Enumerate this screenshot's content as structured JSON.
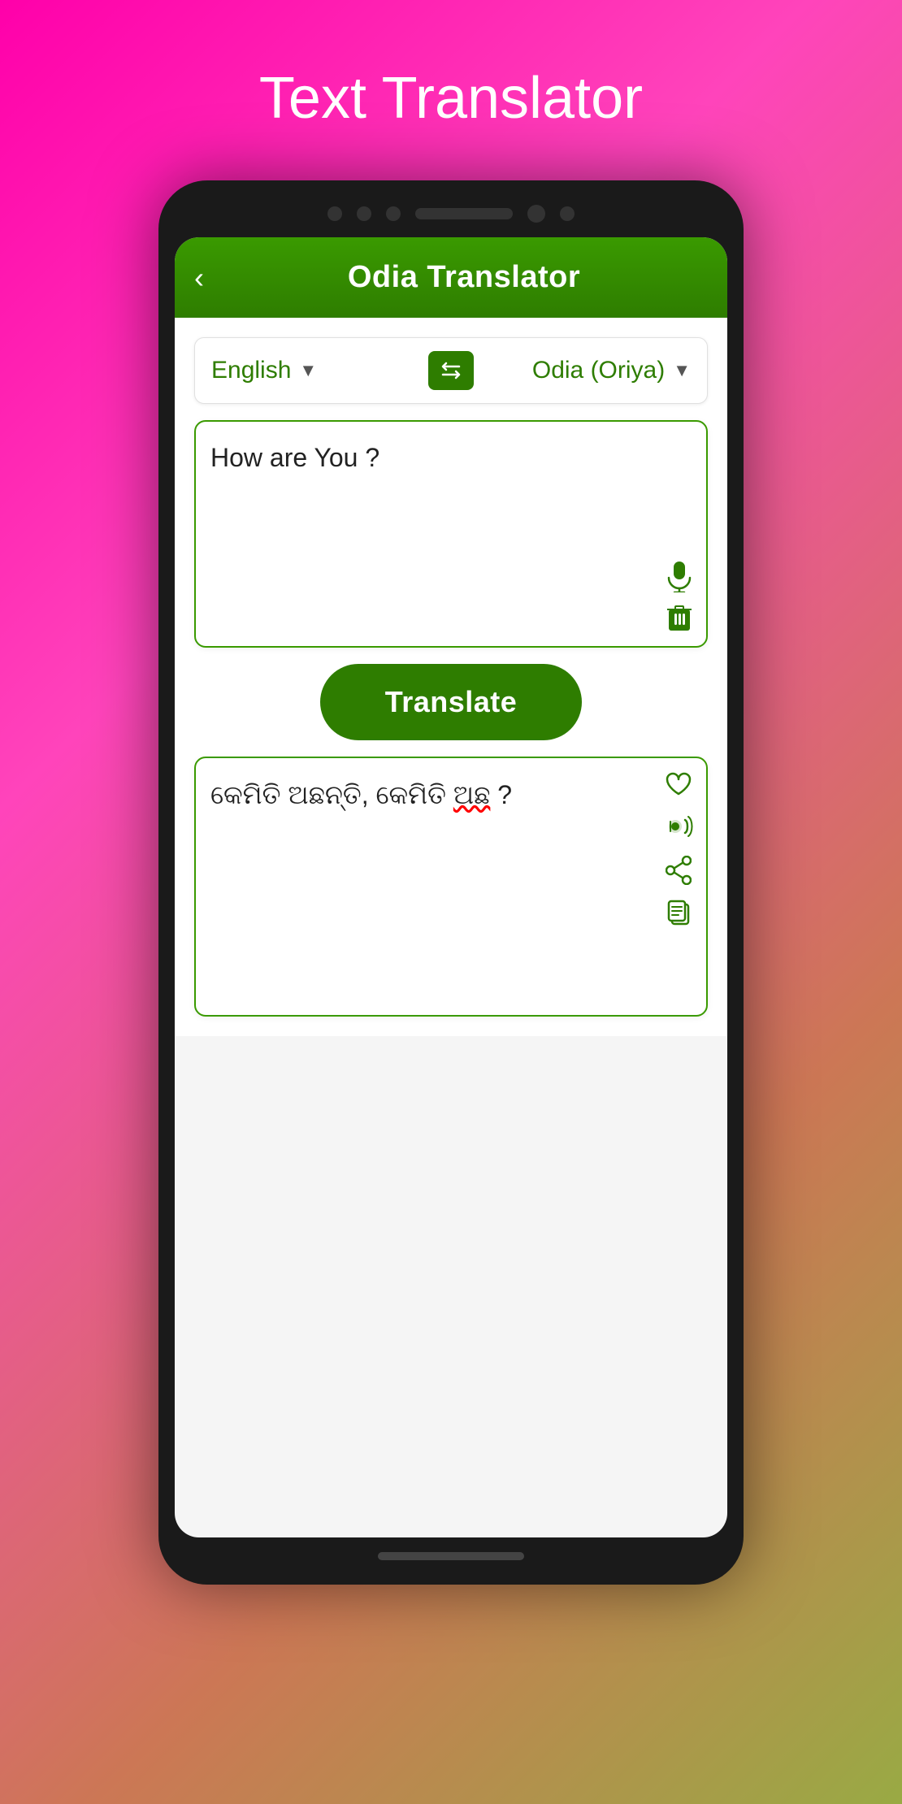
{
  "page": {
    "title": "Text Translator",
    "bg_gradient_start": "#ff00aa",
    "bg_gradient_end": "#99aa44"
  },
  "app": {
    "header_title": "Odia Translator",
    "back_label": "‹",
    "source_language": "English",
    "target_language": "Odia (Oriya)",
    "dropdown_arrow": "▼",
    "swap_symbol": "⇄",
    "input_text": "How are You ?",
    "translated_text": "କେମିତି ଅଛନ୍ତି, କେମିତି ଅଛ ?",
    "translate_button_label": "Translate",
    "mic_icon": "mic",
    "trash_icon": "trash",
    "heart_icon": "heart",
    "speaker_icon": "speaker",
    "share_icon": "share",
    "copy_icon": "copy"
  }
}
